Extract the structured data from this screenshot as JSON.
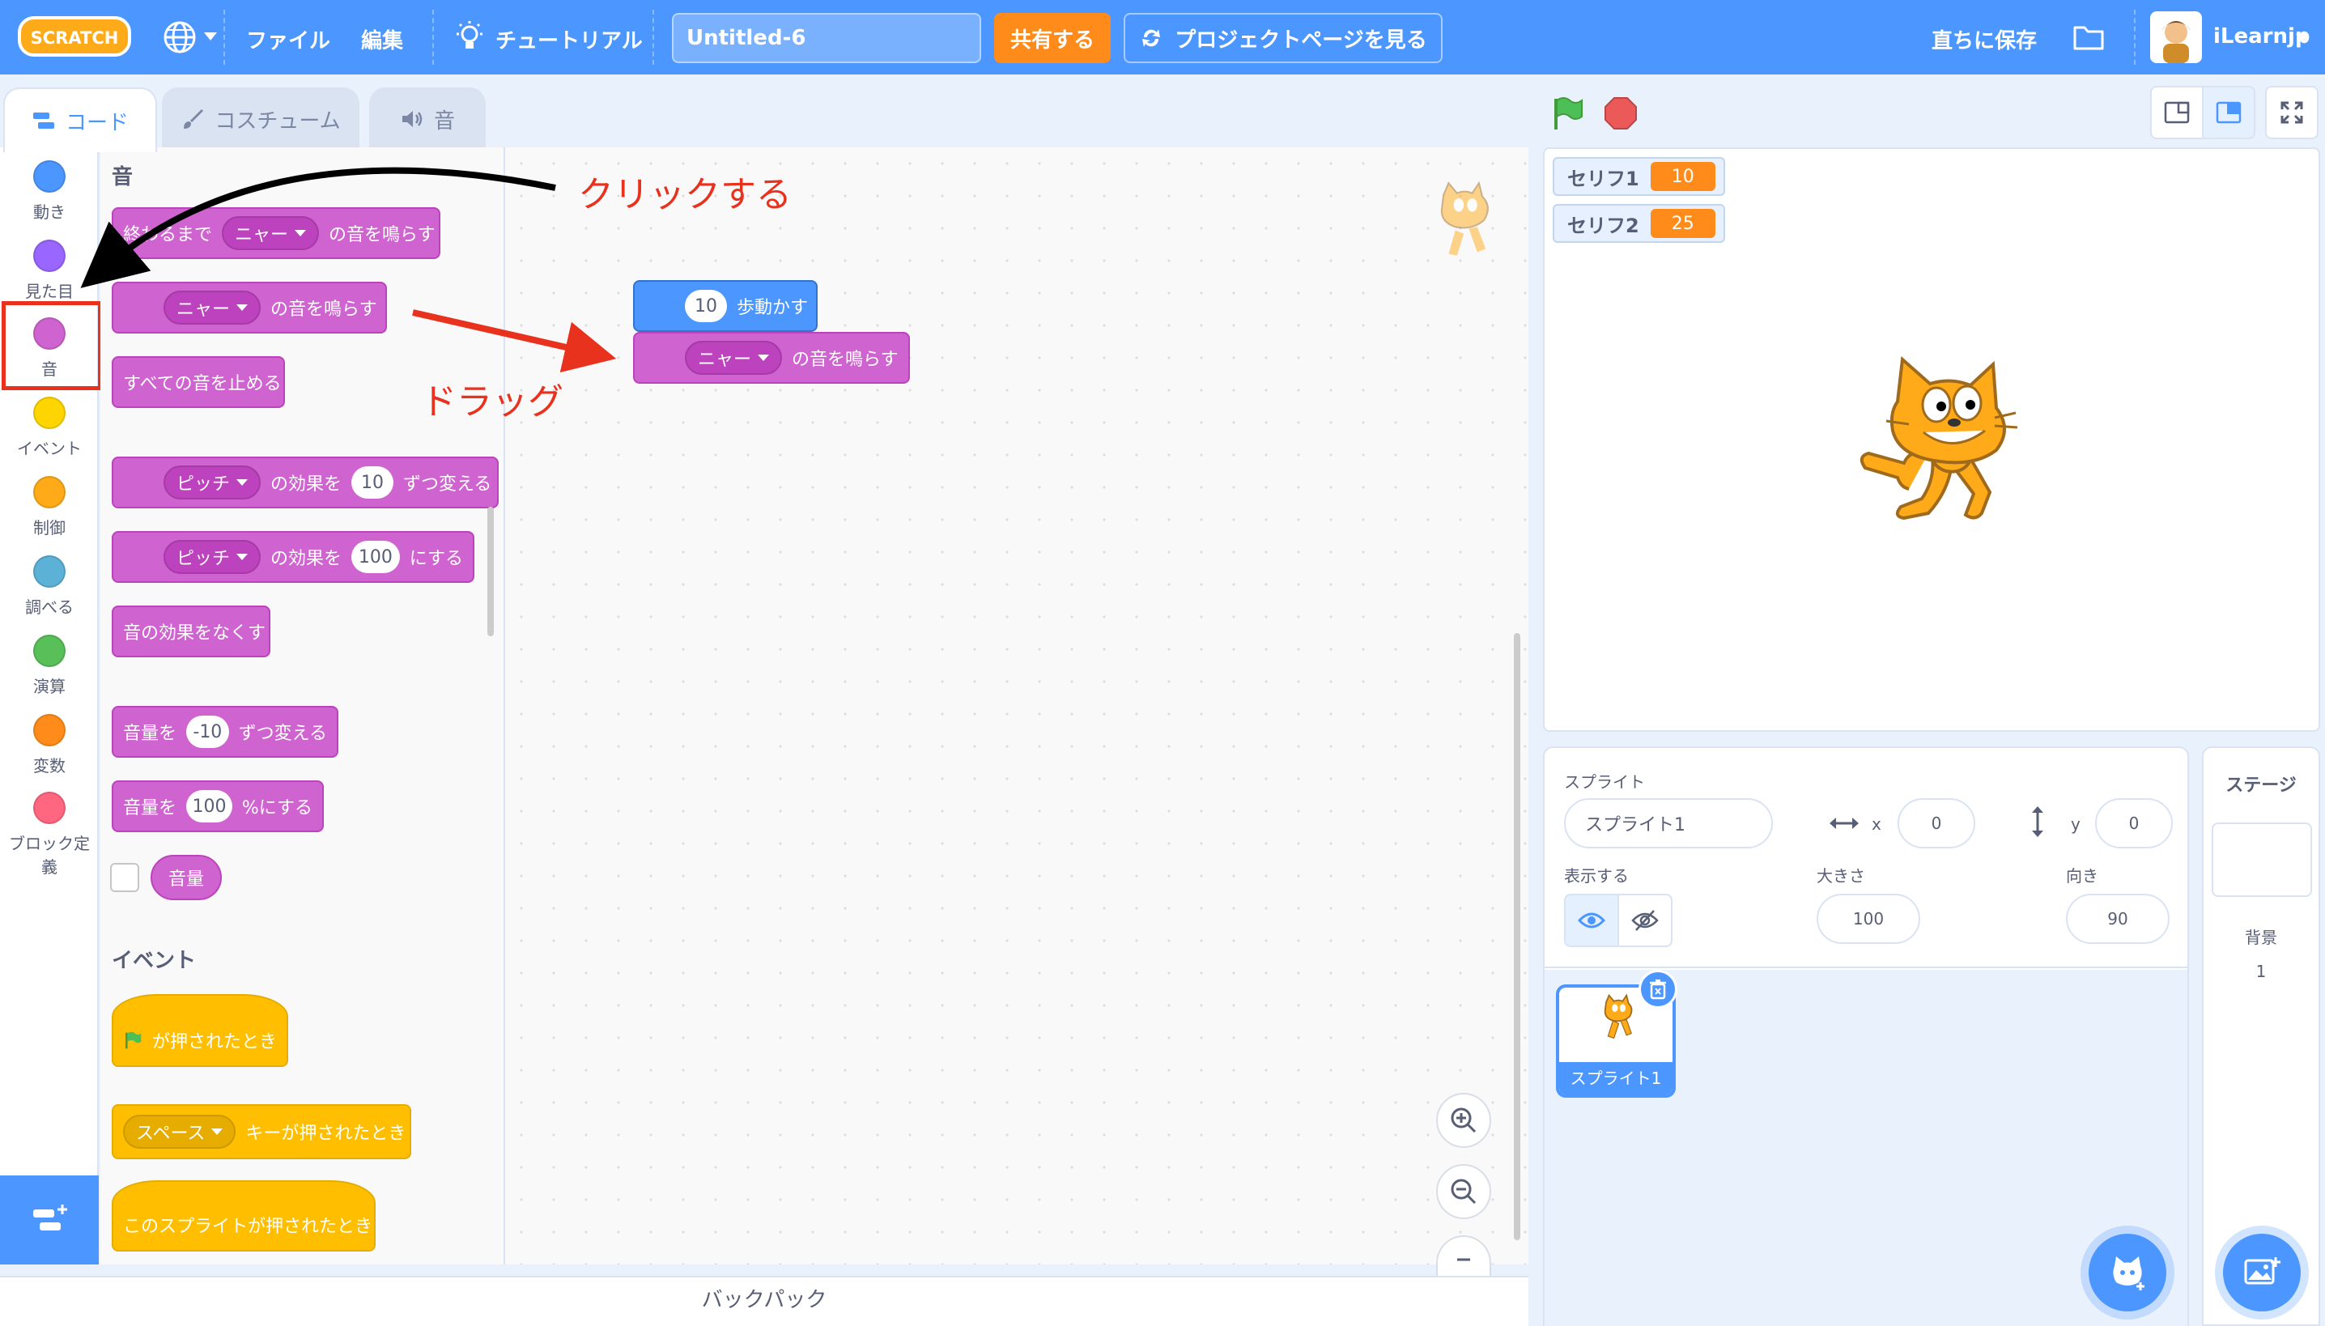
{
  "menubar": {
    "logo_text": "SCRATCH",
    "file": "ファイル",
    "edit": "編集",
    "tutorial": "チュートリアル",
    "project_title": "Untitled-6",
    "share": "共有する",
    "project_page": "プロジェクトページを見る",
    "save_now": "直ちに保存",
    "username": "iLearnjp"
  },
  "tabs": {
    "code": "コード",
    "costume": "コスチューム",
    "sound": "音"
  },
  "categories": [
    {
      "label": "動き",
      "color": "#4c97ff"
    },
    {
      "label": "見た目",
      "color": "#9966ff"
    },
    {
      "label": "音",
      "color": "#cf63cf"
    },
    {
      "label": "イベント",
      "color": "#ffd500"
    },
    {
      "label": "制御",
      "color": "#ffab19"
    },
    {
      "label": "調べる",
      "color": "#5cb1d6"
    },
    {
      "label": "演算",
      "color": "#59c059"
    },
    {
      "label": "変数",
      "color": "#ff8c1a"
    },
    {
      "label": "ブロック定義",
      "color": "#ff6680"
    }
  ],
  "palette": {
    "sound_heading": "音",
    "play_until_done": {
      "prefix": "終わるまで",
      "sound": "ニャー",
      "suffix": "の音を鳴らす"
    },
    "start_sound": {
      "sound": "ニャー",
      "suffix": "の音を鳴らす"
    },
    "stop_all_sounds": "すべての音を止める",
    "change_effect": {
      "effect": "ピッチ",
      "mid": "の効果を",
      "value": "10",
      "suffix": "ずつ変える"
    },
    "set_effect": {
      "effect": "ピッチ",
      "mid": "の効果を",
      "value": "100",
      "suffix": "にする"
    },
    "clear_effects": "音の効果をなくす",
    "change_volume": {
      "prefix": "音量を",
      "value": "-10",
      "suffix": "ずつ変える"
    },
    "set_volume": {
      "prefix": "音量を",
      "value": "100",
      "suffix": "%にする"
    },
    "volume_reporter": "音量",
    "events_heading": "イベント",
    "when_flag_clicked": "が押されたとき",
    "when_key_pressed": {
      "key": "スペース",
      "suffix": "キーが押されたとき"
    },
    "when_sprite_clicked": "このスプライトが押されたとき"
  },
  "workspace": {
    "move_block": {
      "value": "10",
      "suffix": "歩動かす"
    },
    "sound_block": {
      "sound": "ニャー",
      "suffix": "の音を鳴らす"
    }
  },
  "annotations": {
    "click": "クリックする",
    "drag": "ドラッグ",
    "color": "#e8321e"
  },
  "backpack": "バックパック",
  "stage": {
    "monitors": [
      {
        "name": "セリフ1",
        "value": "10"
      },
      {
        "name": "セリフ2",
        "value": "25"
      }
    ]
  },
  "sprite_info": {
    "sprite_label": "スプライト",
    "sprite_name": "スプライト1",
    "x_label": "x",
    "x_value": "0",
    "y_label": "y",
    "y_value": "0",
    "show_label": "表示する",
    "size_label": "大きさ",
    "size_value": "100",
    "direction_label": "向き",
    "direction_value": "90",
    "sprite_tile_name": "スプライト1"
  },
  "stage_pane": {
    "title": "ステージ",
    "backdrop_label": "背景",
    "backdrop_count": "1"
  }
}
